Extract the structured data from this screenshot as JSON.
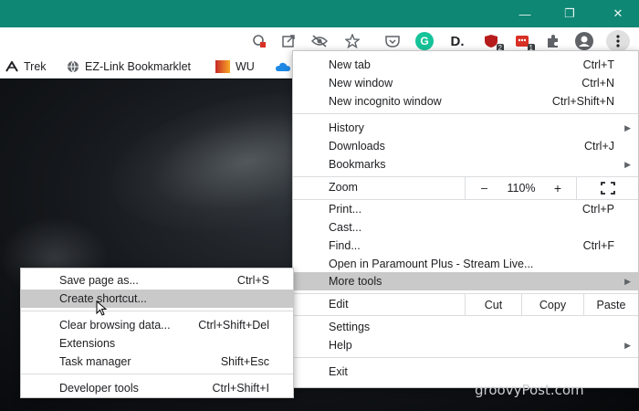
{
  "window": {
    "minimize": "—",
    "maximize": "❐",
    "close": "✕"
  },
  "toolbar": {
    "extension_badge_1": "2",
    "extension_badge_2": "1",
    "grammarly_letter": "G",
    "dlogo_text": "D."
  },
  "bookmarks": [
    {
      "label": "Trek",
      "icon": "trek-icon"
    },
    {
      "label": "EZ-Link Bookmarklet",
      "icon": "globe-icon"
    },
    {
      "label": "WU",
      "icon": "wu-icon"
    }
  ],
  "menu": {
    "new_tab": {
      "label": "New tab",
      "shortcut": "Ctrl+T"
    },
    "new_window": {
      "label": "New window",
      "shortcut": "Ctrl+N"
    },
    "new_incognito": {
      "label": "New incognito window",
      "shortcut": "Ctrl+Shift+N"
    },
    "history": {
      "label": "History"
    },
    "downloads": {
      "label": "Downloads",
      "shortcut": "Ctrl+J"
    },
    "bookmarks": {
      "label": "Bookmarks"
    },
    "zoom": {
      "label": "Zoom",
      "minus": "–",
      "value": "110%",
      "plus": "+"
    },
    "print": {
      "label": "Print...",
      "shortcut": "Ctrl+P"
    },
    "cast": {
      "label": "Cast..."
    },
    "find": {
      "label": "Find...",
      "shortcut": "Ctrl+F"
    },
    "open_in": {
      "label": "Open in Paramount Plus - Stream Live..."
    },
    "more_tools": {
      "label": "More tools"
    },
    "edit": {
      "label": "Edit",
      "cut": "Cut",
      "copy": "Copy",
      "paste": "Paste"
    },
    "settings": {
      "label": "Settings"
    },
    "help": {
      "label": "Help"
    },
    "exit": {
      "label": "Exit"
    }
  },
  "submenu": {
    "save_page": {
      "label": "Save page as...",
      "shortcut": "Ctrl+S"
    },
    "create_shortcut": {
      "label": "Create shortcut..."
    },
    "clear_browsing": {
      "label": "Clear browsing data...",
      "shortcut": "Ctrl+Shift+Del"
    },
    "extensions": {
      "label": "Extensions"
    },
    "task_manager": {
      "label": "Task manager",
      "shortcut": "Shift+Esc"
    },
    "developer_tools": {
      "label": "Developer tools",
      "shortcut": "Ctrl+Shift+I"
    }
  },
  "watermark": "groovyPost.com",
  "colors": {
    "titlebar": "#0e8774",
    "highlight": "#c9c9c9",
    "grammarly": "#15c39a",
    "ext_red": "#d93025"
  }
}
